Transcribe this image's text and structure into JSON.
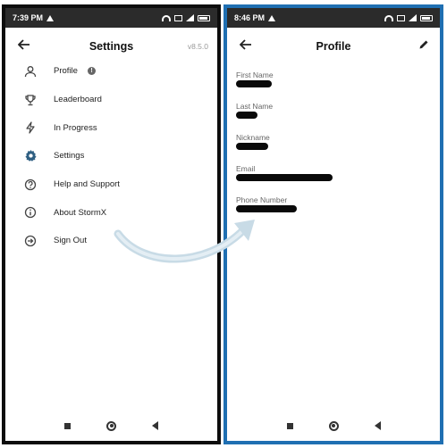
{
  "left_screen": {
    "statusbar": {
      "time": "7:39 PM"
    },
    "appbar": {
      "title": "Settings",
      "version": "v8.5.0"
    },
    "menu": [
      {
        "label": "Profile",
        "icon": "person-icon",
        "badge": "!"
      },
      {
        "label": "Leaderboard",
        "icon": "trophy-icon"
      },
      {
        "label": "In Progress",
        "icon": "lightning-icon"
      },
      {
        "label": "Settings",
        "icon": "gear-icon"
      },
      {
        "label": "Help and Support",
        "icon": "help-icon"
      },
      {
        "label": "About StormX",
        "icon": "info-icon"
      },
      {
        "label": "Sign Out",
        "icon": "sign-out-icon"
      }
    ]
  },
  "right_screen": {
    "statusbar": {
      "time": "8:46 PM"
    },
    "appbar": {
      "title": "Profile"
    },
    "fields": [
      {
        "label": "First Name"
      },
      {
        "label": "Last Name"
      },
      {
        "label": "Nickname"
      },
      {
        "label": "Email"
      },
      {
        "label": "Phone Number"
      }
    ]
  },
  "colors": {
    "left_frame": "#0d0d0d",
    "right_frame": "#1f6fb2",
    "statusbar": "#2b2b2b",
    "arrow": "#c8dbe6"
  }
}
